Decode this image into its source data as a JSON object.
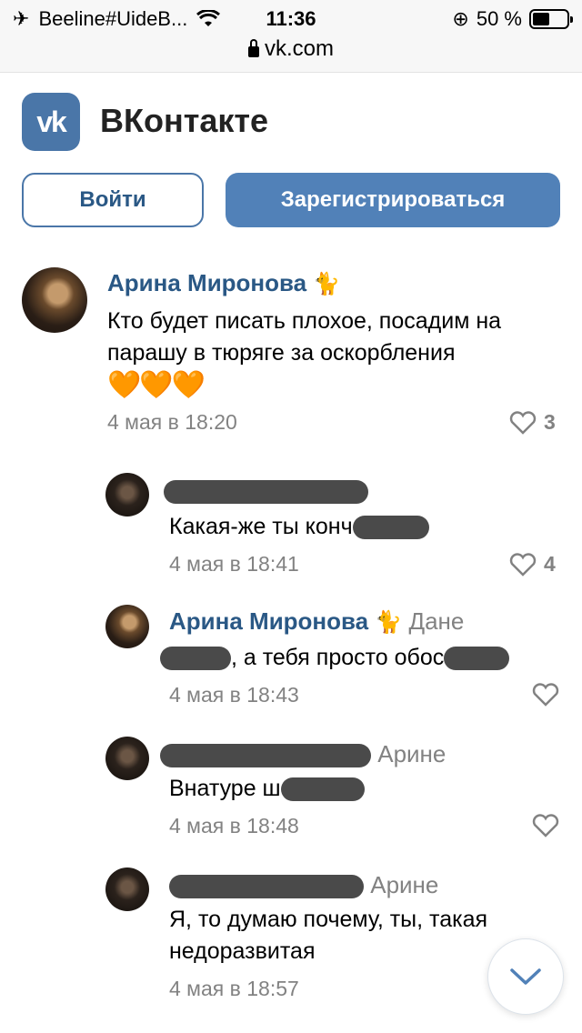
{
  "status_bar": {
    "carrier": "Beeline#UideB...",
    "time": "11:36",
    "battery": "50 %",
    "battery_level": 0.5,
    "url": "vk.com"
  },
  "header": {
    "logo_text": "vk",
    "brand": "ВКонтакте",
    "login_label": "Войти",
    "register_label": "Зарегистрироваться"
  },
  "comments": [
    {
      "author": "Арина Миронова",
      "author_emoji": "🐈",
      "text": "Кто будет писать плохое, посадим на парашу в тюряге за оскорбления",
      "hearts": "🧡🧡🧡",
      "date": "4 мая в 18:20",
      "likes": "3"
    },
    {
      "text_prefix": "Какая-же ты конч",
      "date": "4 мая в 18:41",
      "likes": "4"
    },
    {
      "author": "Арина Миронова",
      "author_emoji": "🐈",
      "reply_to": "Дане",
      "text_suffix": ", а тебя просто обос",
      "date": "4 мая в 18:43"
    },
    {
      "reply_to": "Арине",
      "text_prefix": "Внатуре ш",
      "date": "4 мая в 18:48"
    },
    {
      "reply_to": "Арине",
      "text": "Я, то думаю почему, ты, такая недоразвитая",
      "date": "4 мая в 18:57"
    }
  ],
  "icons": {
    "airplane": "airplane-icon",
    "wifi": "wifi-icon",
    "rotation_lock": "rotation-lock-icon",
    "heart": "heart-icon",
    "chevron_down": "chevron-down-icon"
  },
  "colors": {
    "vk_blue": "#5181b8",
    "link_blue": "#2a5885",
    "muted": "#828282"
  }
}
